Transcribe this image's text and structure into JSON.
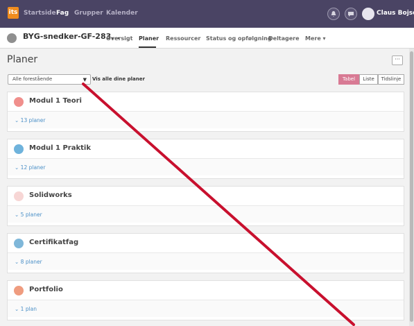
{
  "topbar": {
    "logo": "its",
    "nav": [
      "Startside",
      "Fag",
      "Grupper",
      "Kalender"
    ],
    "active_nav": "Fag",
    "user_name": "Claus Bojsen",
    "bg_color": "#4a4464"
  },
  "course": {
    "title": "BYG-snedker-GF-283...",
    "tabs": [
      "Oversigt",
      "Planer",
      "Ressourcer",
      "Status og opfølgning",
      "Deltagere",
      "Mere ▾"
    ],
    "active_tab": "Planer"
  },
  "page": {
    "title": "Planer",
    "more_button": "···",
    "filter_select": "Alle forestående",
    "show_all_link": "Vis alle dine planer",
    "views": [
      "Tabel",
      "Liste",
      "Tidslinje"
    ],
    "active_view": "Tabel"
  },
  "groups": [
    {
      "title": "Modul 1 Teori",
      "count": "13 planer",
      "color": "#f08f8c"
    },
    {
      "title": "Modul 1 Praktik",
      "count": "12 planer",
      "color": "#6fb3dc"
    },
    {
      "title": "Solidworks",
      "count": "5 planer",
      "color": "#f7d6d5"
    },
    {
      "title": "Certifikatfag",
      "count": "8 planer",
      "color": "#7fb7d9"
    },
    {
      "title": "Portfolio",
      "count": "1 plan",
      "color": "#ef9c7f"
    }
  ],
  "accent_color": "#d87a94",
  "annotation_color": "#c8102e"
}
